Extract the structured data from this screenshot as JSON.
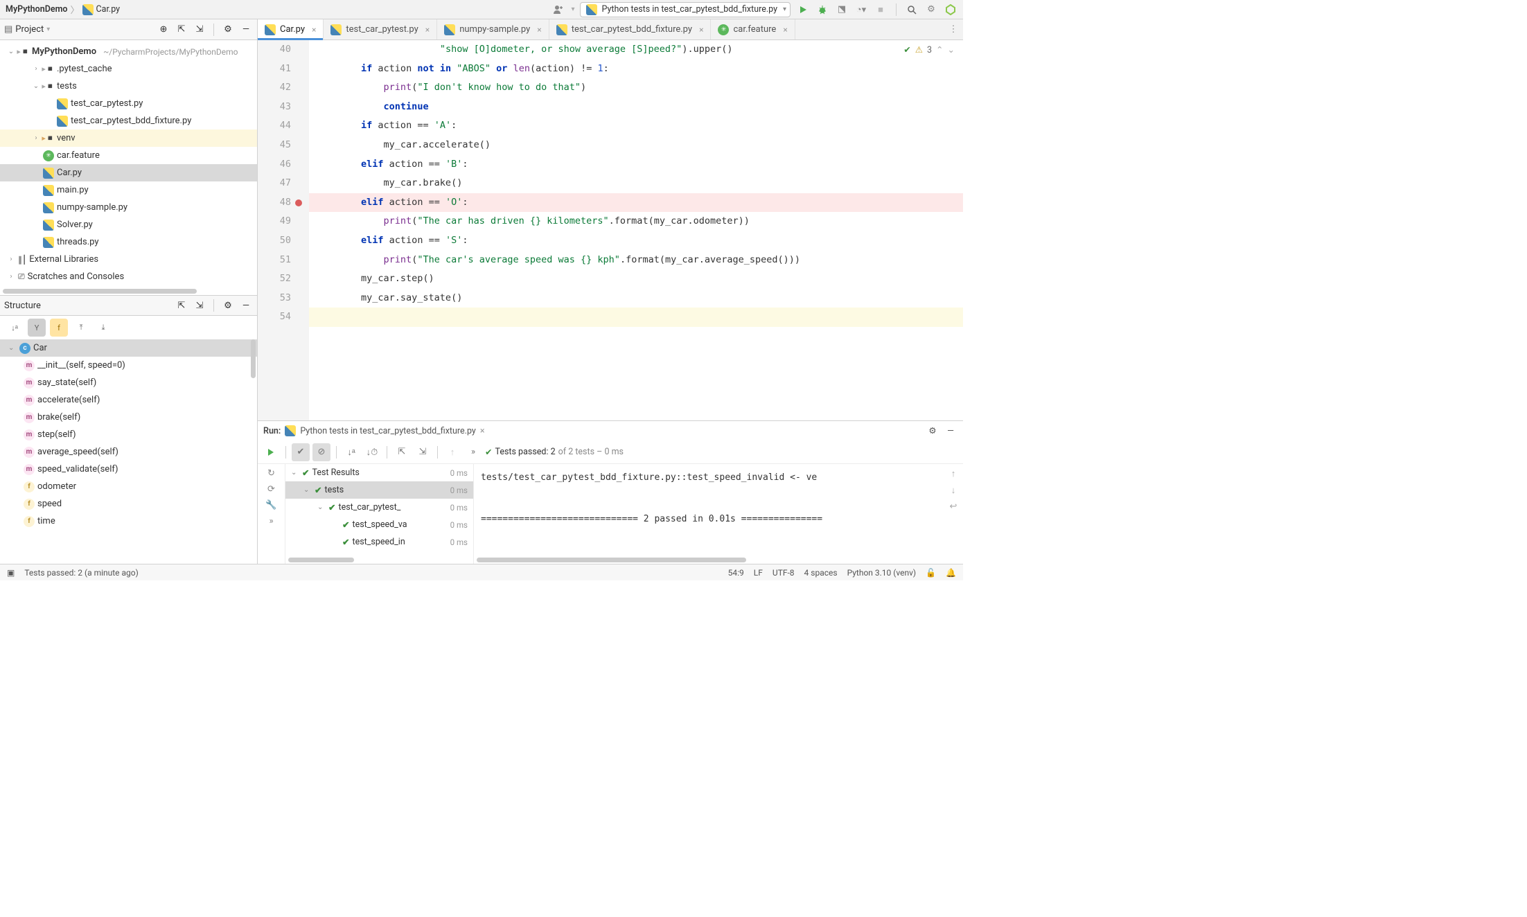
{
  "breadcrumb": {
    "root": "MyPythonDemo",
    "file": "Car.py"
  },
  "run_config": "Python tests in test_car_pytest_bdd_fixture.py",
  "project": {
    "title": "Project",
    "root": {
      "name": "MyPythonDemo",
      "path": "~/PycharmProjects/MyPythonDemo"
    },
    "items": [
      {
        "name": ".pytest_cache",
        "kind": "dir"
      },
      {
        "name": "tests",
        "kind": "dir",
        "open": true
      },
      {
        "name": "test_car_pytest.py",
        "kind": "py",
        "indent": 3
      },
      {
        "name": "test_car_pytest_bdd_fixture.py",
        "kind": "py",
        "indent": 3
      },
      {
        "name": "venv",
        "kind": "venv"
      },
      {
        "name": "car.feature",
        "kind": "feature"
      },
      {
        "name": "Car.py",
        "kind": "py",
        "sel": true
      },
      {
        "name": "main.py",
        "kind": "py"
      },
      {
        "name": "numpy-sample.py",
        "kind": "py"
      },
      {
        "name": "Solver.py",
        "kind": "py"
      },
      {
        "name": "threads.py",
        "kind": "py"
      }
    ],
    "extlib": "External Libraries",
    "scratch": "Scratches and Consoles"
  },
  "structure": {
    "title": "Structure",
    "class": "Car",
    "members": [
      {
        "k": "m",
        "label": "__init__(self, speed=0)"
      },
      {
        "k": "m",
        "label": "say_state(self)"
      },
      {
        "k": "m",
        "label": "accelerate(self)"
      },
      {
        "k": "m",
        "label": "brake(self)"
      },
      {
        "k": "m",
        "label": "step(self)"
      },
      {
        "k": "m",
        "label": "average_speed(self)"
      },
      {
        "k": "m",
        "label": "speed_validate(self)"
      },
      {
        "k": "f",
        "label": "odometer"
      },
      {
        "k": "f",
        "label": "speed"
      },
      {
        "k": "f",
        "label": "time"
      }
    ]
  },
  "tabs": [
    {
      "label": "Car.py",
      "active": true,
      "kind": "py"
    },
    {
      "label": "test_car_pytest.py",
      "kind": "py"
    },
    {
      "label": "numpy-sample.py",
      "kind": "py"
    },
    {
      "label": "test_car_pytest_bdd_fixture.py",
      "kind": "py"
    },
    {
      "label": "car.feature",
      "kind": "feature"
    }
  ],
  "editor": {
    "warn_count": "3",
    "lines": [
      {
        "n": 40,
        "html": "                      <span class='str'>\"show [O]dometer, or show average [S]peed?\"</span>).upper()"
      },
      {
        "n": 41,
        "html": "        <span class='kw'>if</span> action <span class='kw'>not in</span> <span class='str'>\"ABOS\"</span> <span class='kw'>or</span> <span class='fn'>len</span>(action) != <span class='num'>1</span>:"
      },
      {
        "n": 42,
        "html": "            <span class='fn'>print</span>(<span class='str'>\"I don't know how to do that\"</span>)"
      },
      {
        "n": 43,
        "html": "            <span class='kw'>continue</span>"
      },
      {
        "n": 44,
        "html": "        <span class='kw'>if</span> action == <span class='str'>'A'</span>:"
      },
      {
        "n": 45,
        "html": "            my_car.accelerate()"
      },
      {
        "n": 46,
        "html": "        <span class='kw'>elif</span> action == <span class='str'>'B'</span>:"
      },
      {
        "n": 47,
        "html": "            my_car.brake()"
      },
      {
        "n": 48,
        "bp": true,
        "html": "        <span class='kw'>elif</span> action == <span class='str'>'O'</span>:"
      },
      {
        "n": 49,
        "html": "            <span class='fn'>print</span>(<span class='str'>\"The car has driven {} kilometers\"</span>.format(my_car.odometer))"
      },
      {
        "n": 50,
        "html": "        <span class='kw'>elif</span> action == <span class='str'>'S'</span>:"
      },
      {
        "n": 51,
        "html": "            <span class='fn'>print</span>(<span class='str'>\"The car's average speed was {} kph\"</span>.format(my_car.average_speed()))"
      },
      {
        "n": 52,
        "html": "        my_car.step()"
      },
      {
        "n": 53,
        "html": "        my_car.say_state()"
      },
      {
        "n": 54,
        "cur": true,
        "html": ""
      }
    ]
  },
  "run": {
    "label": "Run:",
    "title": "Python tests in test_car_pytest_bdd_fixture.py",
    "summary_pre": "Tests passed: 2",
    "summary_post": " of 2 tests – 0 ms",
    "tree": [
      {
        "label": "Test Results",
        "time": "0 ms",
        "indent": 0
      },
      {
        "label": "tests",
        "time": "0 ms",
        "indent": 1,
        "sel": true
      },
      {
        "label": "test_car_pytest_",
        "time": "0 ms",
        "indent": 2
      },
      {
        "label": "test_speed_va",
        "time": "0 ms",
        "indent": 3
      },
      {
        "label": "test_speed_in",
        "time": "0 ms",
        "indent": 3
      }
    ],
    "output_l1": "tests/test_car_pytest_bdd_fixture.py::test_speed_invalid <- ve",
    "output_l2": "============================= 2 passed in 0.01s ==============="
  },
  "status": {
    "left": "Tests passed: 2 (a minute ago)",
    "caret": "54:9",
    "eol": "LF",
    "enc": "UTF-8",
    "indent": "4 spaces",
    "sdk": "Python 3.10 (venv)"
  }
}
